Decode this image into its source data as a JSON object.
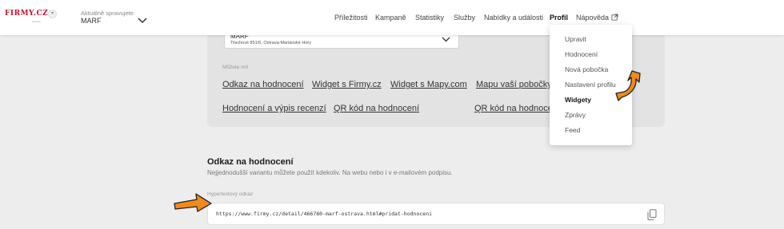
{
  "header": {
    "logo": "FIRMY.CZ",
    "logo_sub": "Seznam",
    "manage_label": "Aktuálně spravujete",
    "manage_value": "MARF"
  },
  "nav": {
    "items": [
      "Příležitosti",
      "Kampaně",
      "Statistiky",
      "Služby",
      "Nabídky a události",
      "Profil",
      "Nápověda"
    ],
    "active": "Profil"
  },
  "select": {
    "name": "MARF",
    "address": "Tilschové 851/6, Ostrava-Mariánské Hory"
  },
  "card": {
    "subtitle": "Můžete mít",
    "links_row1": [
      "Odkaz na hodnocení",
      "Widget s Firmy.cz",
      "Widget s Mapy.com",
      "Mapu vaší pobočky"
    ],
    "links_row2": [
      "Hodnocení a výpis recenzí",
      "QR kód na hodnocení",
      "QR kód na hodnoce"
    ]
  },
  "section": {
    "title": "Odkaz na hodnocení",
    "description": "Nejjednodušší variantu můžete použít kdekoliv. Na webu nebo i v e-mailovém podpisu.",
    "field_label": "Hypertextový odkaz",
    "field_value": "https://www.firmy.cz/detail/466780-marf-ostrava.html#pridat-hodnoceni"
  },
  "dropdown": {
    "items": [
      "Upravit",
      "Hodnocení",
      "Nová pobočka",
      "Nastavení profilu",
      "Widgety",
      "Zprávy",
      "Feed"
    ],
    "active": "Widgety"
  },
  "colors": {
    "brand": "#c8102e",
    "arrow": "#f08a1c"
  }
}
